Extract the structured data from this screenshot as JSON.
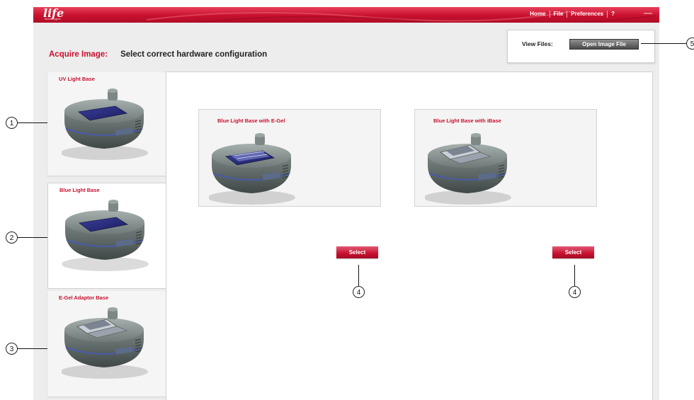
{
  "app": {
    "logo": "life",
    "logo_sub": "technologies"
  },
  "menu": {
    "items": [
      "Home",
      "File",
      "Preferences",
      "?"
    ]
  },
  "window": {
    "minimize": "—"
  },
  "heading": {
    "acquire": "Acquire Image:",
    "subtitle": "Select correct hardware configuration"
  },
  "view_files": {
    "label": "View Files:",
    "button": "Open Image File"
  },
  "sidebar": {
    "items": [
      {
        "label": "UV Light Base",
        "selected": false
      },
      {
        "label": "Blue Light Base",
        "selected": true
      },
      {
        "label": "E-Gel Adaptor Base",
        "selected": false
      }
    ]
  },
  "cards": [
    {
      "title": "Blue Light Base with E-Gel",
      "button": "Select"
    },
    {
      "title": "Blue Light Base with iBase",
      "button": "Select"
    }
  ],
  "callouts": [
    "1",
    "2",
    "3",
    "4",
    "4",
    "5"
  ],
  "colors": {
    "brand": "#c8102e",
    "panel": "#ededed",
    "device": "#5a6563"
  }
}
